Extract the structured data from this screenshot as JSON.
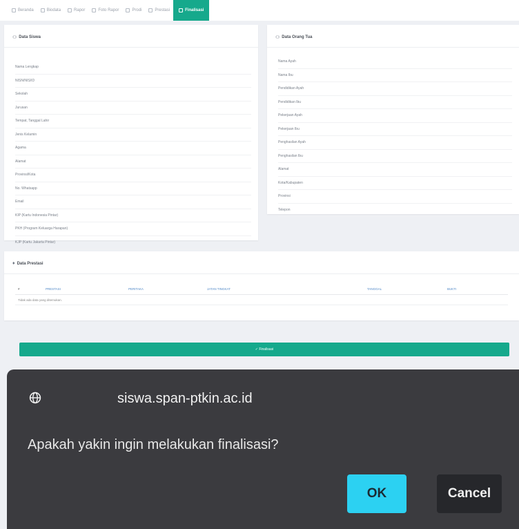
{
  "nav": {
    "items": [
      {
        "label": "Beranda",
        "icon": "home-icon"
      },
      {
        "label": "Biodata",
        "icon": "user-icon"
      },
      {
        "label": "Rapor",
        "icon": "book-icon"
      },
      {
        "label": "Foto Rapor",
        "icon": "image-icon"
      },
      {
        "label": "Prodi",
        "icon": "grid-icon"
      },
      {
        "label": "Prestasi",
        "icon": "award-icon"
      },
      {
        "label": "Finalisasi",
        "icon": "check-icon",
        "active": true
      }
    ]
  },
  "siswa": {
    "title": "Data Siswa",
    "fields": [
      "Nama Lengkap",
      "NISN/NIS/ID",
      "Sekolah",
      "Jurusan",
      "Tempat, Tanggal Lahir",
      "Jenis Kelamin",
      "Agama",
      "Alamat",
      "Provinsi/Kota",
      "No. Whatsapp",
      "Email",
      "KIP (Kartu Indonesia Pintar)",
      "PKH (Program Keluarga Harapan)",
      "KJP (Kartu Jakarta Pintar)"
    ]
  },
  "ortu": {
    "title": "Data Orang Tua",
    "fields": [
      "Nama Ayah",
      "Nama Ibu",
      "Pendidikan Ayah",
      "Pendidikan Ibu",
      "Pekerjaan Ayah",
      "Pekerjaan Ibu",
      "Penghasilan Ayah",
      "Penghasilan Ibu",
      "Alamat",
      "Kota/Kabupaten",
      "Provinsi",
      "Telepon"
    ]
  },
  "prestasi": {
    "title": "Data Prestasi",
    "columns": [
      "#",
      "PRESTASI",
      "PERITAKA",
      "JATAN TINGKAT",
      "TANGGAL",
      "BUKTI"
    ],
    "empty_text": "Tidak ada data yang ditemukan."
  },
  "finalize": {
    "label": "✓ Finalisasi"
  },
  "dialog": {
    "host": "siswa.span-ptkin.ac.id",
    "message": "Apakah yakin ingin melakukan finalisasi?",
    "ok_label": "OK",
    "cancel_label": "Cancel"
  },
  "colors": {
    "accent": "#16a98c",
    "dialog_bg": "#3b3b3f",
    "ok_bg": "#2cd1f2"
  }
}
